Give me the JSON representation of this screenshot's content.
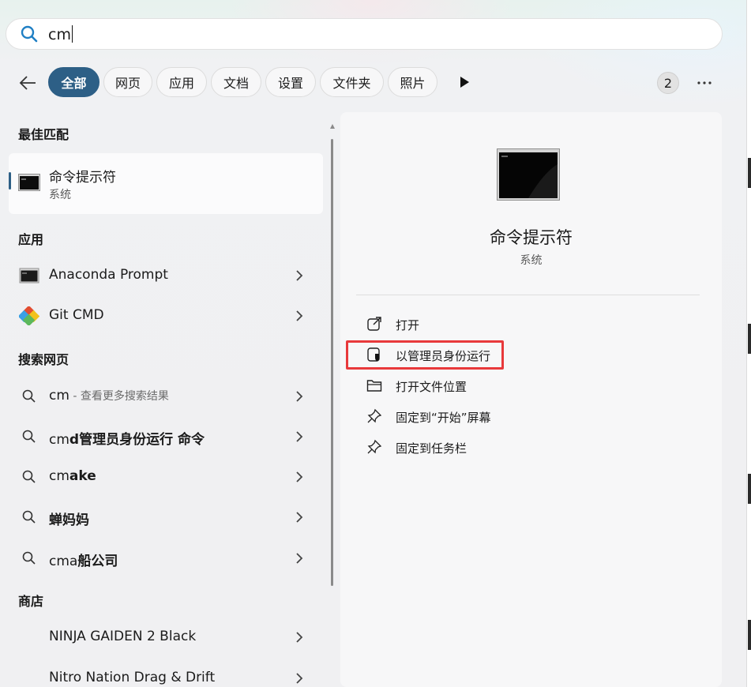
{
  "search": {
    "value": "cm"
  },
  "filters": {
    "chips": [
      "全部",
      "网页",
      "应用",
      "文档",
      "设置",
      "文件夹",
      "照片"
    ],
    "badge_count": "2"
  },
  "left": {
    "best_match_header": "最佳匹配",
    "best_match": {
      "title": "命令提示符",
      "subtitle": "系统"
    },
    "apps_header": "应用",
    "apps": [
      "Anaconda Prompt",
      "Git CMD"
    ],
    "web_header": "搜索网页",
    "web": [
      {
        "pre": "cm",
        "bold": "",
        "suffix": " - 查看更多搜索结果"
      },
      {
        "pre": "cm",
        "bold": "d管理员身份运行 命令",
        "suffix": ""
      },
      {
        "pre": "cm",
        "bold": "ake",
        "suffix": ""
      },
      {
        "pre": "",
        "bold": "蝉妈妈",
        "suffix": ""
      },
      {
        "pre": "cma",
        "bold": "船公司",
        "suffix": ""
      }
    ],
    "store_header": "商店",
    "store": [
      "NINJA GAIDEN 2 Black",
      "Nitro Nation Drag & Drift"
    ]
  },
  "detail": {
    "title": "命令提示符",
    "subtitle": "系统",
    "actions": [
      "打开",
      "以管理员身份运行",
      "打开文件位置",
      "固定到“开始”屏幕",
      "固定到任务栏"
    ],
    "highlighted_action": "以管理员身份运行"
  },
  "colors": {
    "accent": "#2d5f86",
    "highlight": "#e8393b",
    "search_icon": "#1f7fc4"
  },
  "icons": {
    "search": "search-icon",
    "back": "back-arrow-icon",
    "play": "play-icon",
    "more": "more-icon",
    "cmd": "cmd-icon",
    "git": "git-icon",
    "chevron": "chevron-right-icon",
    "open": "open-external-icon",
    "admin": "shield-icon",
    "folder": "folder-icon",
    "pin": "pin-icon"
  }
}
